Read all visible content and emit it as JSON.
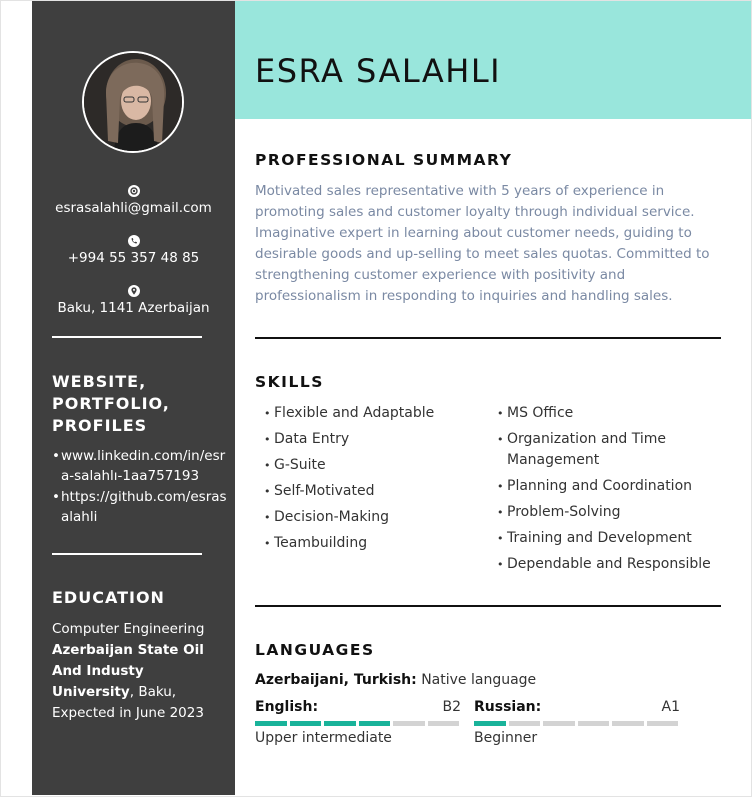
{
  "name": "ESRA SALAHLI",
  "contact": {
    "email": "esrasalahli@gmail.com",
    "phone": "+994 55 357 48 85",
    "location": "Baku, 1141 Azerbaijan"
  },
  "profiles": {
    "heading": "WEBSITE, PORTFOLIO, PROFILES",
    "items": [
      "www.linkedin.com/in/esra-salahlı-1aa757193",
      "https://github.com/esrasalahli"
    ]
  },
  "education": {
    "heading": "EDUCATION",
    "degree": "Computer Engineering",
    "school": "Azerbaijan State Oil And Industy University",
    "city": ", Baku,",
    "expected": "Expected in June 2023"
  },
  "summary": {
    "heading": "PROFESSIONAL SUMMARY",
    "text": "Motivated sales representative with 5 years of experience in promoting sales and customer loyalty through individual service. Imaginative expert in learning about customer needs, guiding to desirable goods and up-selling to meet sales quotas. Committed to strengthening customer experience with positivity and professionalism in responding to inquiries and handling sales."
  },
  "skills": {
    "heading": "SKILLS",
    "left": [
      "Flexible and Adaptable",
      "Data Entry",
      "G-Suite",
      "Self-Motivated",
      "Decision-Making",
      "Teambuilding"
    ],
    "right": [
      "MS Office",
      "Organization and Time Management",
      "Planning and Coordination",
      "Problem-Solving",
      "Training and Development",
      "Dependable and Responsible"
    ]
  },
  "languages": {
    "heading": "LANGUAGES",
    "native_label": "Azerbaijani, Turkish:",
    "native_value": "Native language",
    "items": [
      {
        "name": "English:",
        "code": "B2",
        "level": "Upper intermediate",
        "filled": 4,
        "total": 6
      },
      {
        "name": "Russian:",
        "code": "A1",
        "level": "Beginner",
        "filled": 1,
        "total": 6
      }
    ]
  },
  "colors": {
    "sidebar": "#3f3f3f",
    "header": "#99e6dc",
    "accent": "#19b39a",
    "summary_text": "#7a89a3"
  }
}
